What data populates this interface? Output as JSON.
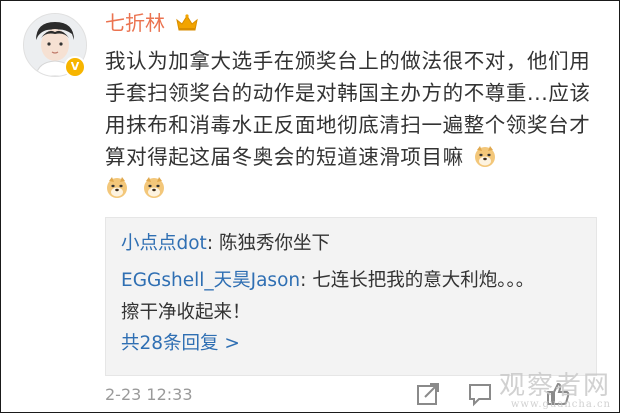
{
  "post": {
    "username": "七折林",
    "content": "我认为加拿大选手在颁奖台上的做法很不对，他们用手套扫领奖台的动作是对韩国主办方的不尊重...应该用抹布和消毒水正反面地彻底清扫一遍整个领奖台才算对得起这届冬奥会的短道速滑项目嘛",
    "emoji_inline": "doge",
    "emoji_trailing": [
      "doge",
      "doge"
    ],
    "timestamp": "2-23 12:33"
  },
  "replies": [
    {
      "author": "小点点dot",
      "separator": ": ",
      "text": "陈独秀你坐下"
    },
    {
      "author": "EGGshell_天昊Jason",
      "separator": ": ",
      "text": "七连长把我的意大利炮。。。擦干净收起来！"
    }
  ],
  "more_replies": "共28条回复 >",
  "actions": {
    "share": "share-icon",
    "comment": "comment-icon",
    "like": "like-icon"
  },
  "watermark": {
    "main": "观察者网",
    "sub": "www.guancha.cn"
  },
  "colors": {
    "username": "#eb7350",
    "link": "#2f6fb3",
    "reply_bg": "#f3f3f3",
    "crown": "#f2a400"
  }
}
